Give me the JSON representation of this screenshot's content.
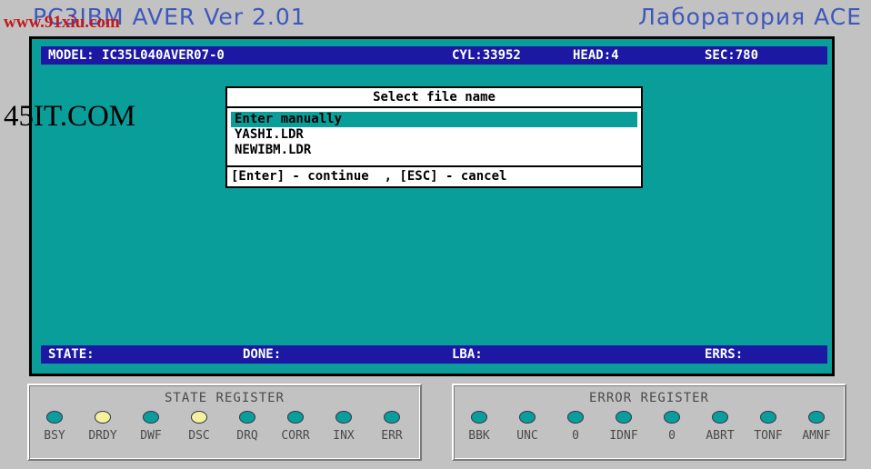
{
  "window": {
    "title": "PC3IBM AVER Ver 2.01",
    "lab": "Лаборатория ACE"
  },
  "watermarks": {
    "top": "www.91xiu.com",
    "side": "45IT.COM"
  },
  "info_top": {
    "model": "MODEL: IC35L040AVER07-0",
    "cyl": "CYL:33952",
    "head": "HEAD:4",
    "sec": "SEC:780"
  },
  "info_bottom": {
    "state": "STATE:",
    "done": "DONE:",
    "lba": "LBA:",
    "errs": "ERRS:"
  },
  "dialog": {
    "title": "Select file name",
    "items": [
      "Enter manually",
      "YASHI.LDR",
      "NEWIBM.LDR"
    ],
    "selected_index": 0,
    "footer": "[Enter] - continue  , [ESC] - cancel"
  },
  "state_register": {
    "title": "STATE REGISTER",
    "lamps": [
      {
        "label": "BSY",
        "on": false
      },
      {
        "label": "DRDY",
        "on": true
      },
      {
        "label": "DWF",
        "on": false
      },
      {
        "label": "DSC",
        "on": true
      },
      {
        "label": "DRQ",
        "on": false
      },
      {
        "label": "CORR",
        "on": false
      },
      {
        "label": "INX",
        "on": false
      },
      {
        "label": "ERR",
        "on": false
      }
    ]
  },
  "error_register": {
    "title": "ERROR REGISTER",
    "lamps": [
      {
        "label": "BBK",
        "on": false
      },
      {
        "label": "UNC",
        "on": false
      },
      {
        "label": "0",
        "on": false
      },
      {
        "label": "IDNF",
        "on": false
      },
      {
        "label": "0",
        "on": false
      },
      {
        "label": "ABRT",
        "on": false
      },
      {
        "label": "TONF",
        "on": false
      },
      {
        "label": "AMNF",
        "on": false
      }
    ]
  },
  "colors": {
    "lamp_off": "#0a9e9a",
    "lamp_on": "#f2f29a",
    "screen_bg": "#0a9e9a",
    "bar_bg": "#1c18a4"
  }
}
